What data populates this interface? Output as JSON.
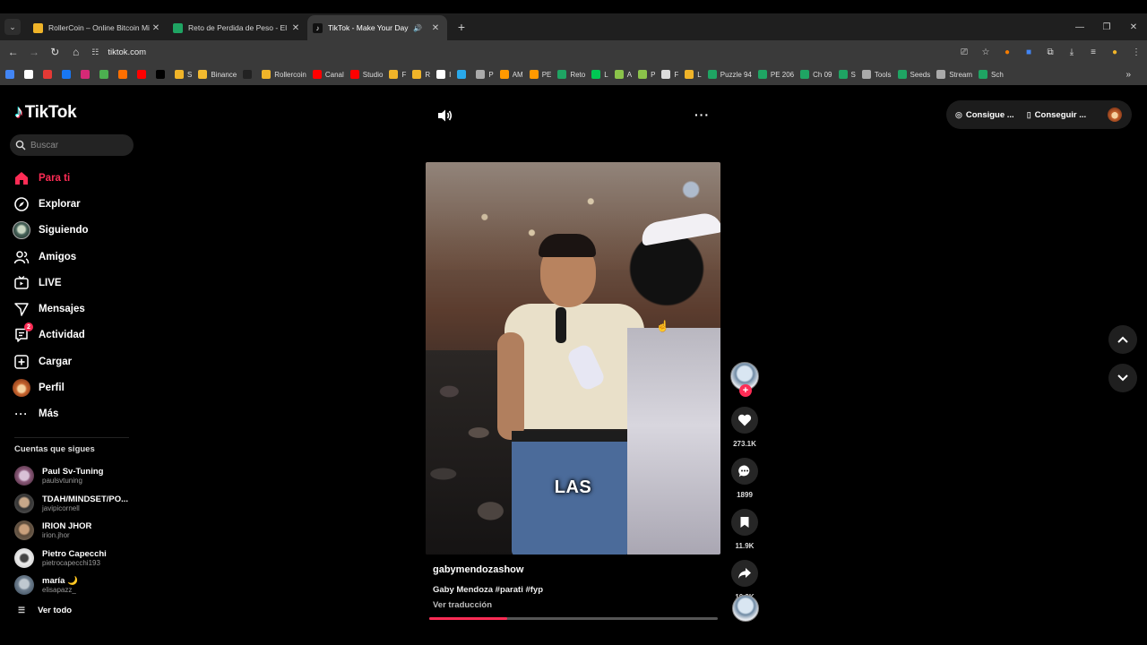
{
  "browser": {
    "tabs": [
      {
        "title": "RollerCoin – Online Bitcoin Mining",
        "favicon_color": "#f0b429"
      },
      {
        "title": "Reto de Perdida de Peso - El Método",
        "favicon_color": "#1fa463"
      },
      {
        "title": "TikTok - Make Your Day",
        "favicon_color": "#111111"
      }
    ],
    "url": "tiktok.com",
    "bookmarks": [
      {
        "label": "",
        "color": "#4285f4"
      },
      {
        "label": "",
        "color": "#ffffff"
      },
      {
        "label": "",
        "color": "#e53935"
      },
      {
        "label": "",
        "color": "#1877f2"
      },
      {
        "label": "",
        "color": "#d62976"
      },
      {
        "label": "",
        "color": "#4caf50"
      },
      {
        "label": "",
        "color": "#ff6f00"
      },
      {
        "label": "",
        "color": "#ff0000"
      },
      {
        "label": "",
        "color": "#000000"
      },
      {
        "label": "S",
        "color": "#f0b429"
      },
      {
        "label": "Binance",
        "color": "#f3ba2f"
      },
      {
        "label": "",
        "color": "#222222"
      },
      {
        "label": "Rollercoin",
        "color": "#f0b429"
      },
      {
        "label": "Canal",
        "color": "#ff0000"
      },
      {
        "label": "Studio",
        "color": "#ff0000"
      },
      {
        "label": "F",
        "color": "#f0b429"
      },
      {
        "label": "R",
        "color": "#f0b429"
      },
      {
        "label": "I",
        "color": "#ffffff"
      },
      {
        "label": "",
        "color": "#29a9eb"
      },
      {
        "label": "P",
        "color": "#aaaaaa"
      },
      {
        "label": "AM",
        "color": "#ff9900"
      },
      {
        "label": "PE",
        "color": "#ff9900"
      },
      {
        "label": "Reto",
        "color": "#1fa463"
      },
      {
        "label": "L",
        "color": "#00c853"
      },
      {
        "label": "A",
        "color": "#8bc34a"
      },
      {
        "label": "P",
        "color": "#8bc34a"
      },
      {
        "label": "F",
        "color": "#dddddd"
      },
      {
        "label": "L",
        "color": "#f0b429"
      },
      {
        "label": "Puzzle 94",
        "color": "#1fa463"
      },
      {
        "label": "PE 206",
        "color": "#1fa463"
      },
      {
        "label": "Ch 09",
        "color": "#1fa463"
      },
      {
        "label": "S",
        "color": "#1fa463"
      },
      {
        "label": "Tools",
        "color": "#aaaaaa"
      },
      {
        "label": "Seeds",
        "color": "#1fa463"
      },
      {
        "label": "Stream",
        "color": "#aaaaaa"
      },
      {
        "label": "Sch",
        "color": "#1fa463"
      }
    ]
  },
  "tiktok": {
    "brand": "TikTok",
    "search_placeholder": "Buscar",
    "nav": [
      {
        "label": "Para ti",
        "icon": "home-icon",
        "active": true
      },
      {
        "label": "Explorar",
        "icon": "compass-icon"
      },
      {
        "label": "Siguiendo",
        "icon": "following-avatar-icon"
      },
      {
        "label": "Amigos",
        "icon": "friends-icon"
      },
      {
        "label": "LIVE",
        "icon": "live-icon"
      },
      {
        "label": "Mensajes",
        "icon": "messages-icon"
      },
      {
        "label": "Actividad",
        "icon": "activity-icon",
        "badge": "2"
      },
      {
        "label": "Cargar",
        "icon": "upload-icon"
      },
      {
        "label": "Perfil",
        "icon": "profile-avatar-icon"
      },
      {
        "label": "Más",
        "icon": "more-icon"
      }
    ],
    "following_header": "Cuentas que sigues",
    "following": [
      {
        "name": "Paul Sv-Tuning",
        "username": "paulsvtuning",
        "color": "#8a5a7a"
      },
      {
        "name": "TDAH/MINDSET/PO...",
        "username": "javipicornell",
        "color": "#555555"
      },
      {
        "name": "IRION JHOR",
        "username": "irion.jhor",
        "color": "#7a6a5a"
      },
      {
        "name": "Pietro Capecchi",
        "username": "pietrocapecchi193",
        "color": "#dddddd"
      },
      {
        "name": "maría 🌙",
        "username": "elisapazz_",
        "color": "#6d7d8d"
      }
    ],
    "see_all": "Ver todo",
    "get_app": [
      "Consigue ...",
      "Conseguir ..."
    ],
    "video": {
      "caption": "LAS",
      "author": "gabymendozashow",
      "description": "Gaby Mendoza #parati #fyp",
      "translate": "Ver traducción",
      "progress": 0.27
    },
    "actions": {
      "likes": "273.1K",
      "comments": "1899",
      "saves": "11.9K",
      "shares": "10.2K"
    },
    "colors": {
      "accent": "#fe2c55"
    }
  }
}
